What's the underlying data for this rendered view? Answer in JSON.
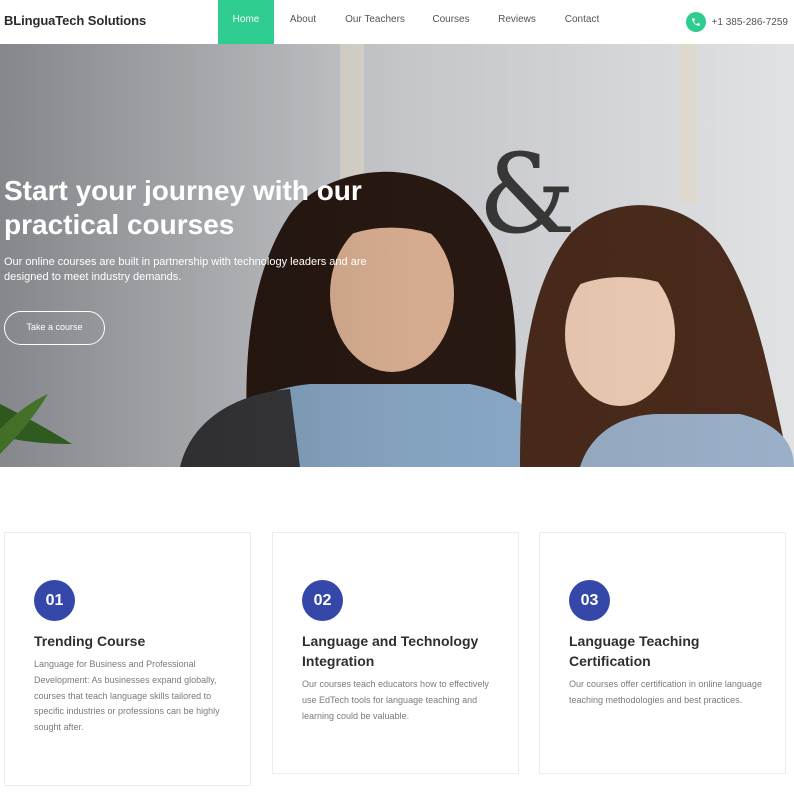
{
  "header": {
    "brand": "BLinguaTech Solutions",
    "nav": [
      {
        "label": "Home",
        "active": true
      },
      {
        "label": "About",
        "active": false
      },
      {
        "label": "Our Teachers",
        "active": false
      },
      {
        "label": "Courses",
        "active": false
      },
      {
        "label": "Reviews",
        "active": false
      },
      {
        "label": "Contact",
        "active": false
      }
    ],
    "phone": "+1 385-286-7259",
    "phone_icon": "phone-icon"
  },
  "hero": {
    "title": "Start your journey with our practical courses",
    "subtitle": "Our online courses are built in partnership with technology leaders and are designed to meet industry demands.",
    "cta": "Take a course"
  },
  "features": [
    {
      "number": "01",
      "title": "Trending Course",
      "description": "Language for Business and Professional Development: As businesses expand globally, courses that teach language skills tailored to specific industries or professions can be highly sought after."
    },
    {
      "number": "02",
      "title": "Language and Technology Integration",
      "description": "Our courses teach educators how to effectively use EdTech tools for language teaching and learning could be valuable."
    },
    {
      "number": "03",
      "title": "Language Teaching Certification",
      "description": "Our courses offer certification in online language teaching methodologies and best practices."
    }
  ],
  "colors": {
    "accent": "#2ecc8f",
    "number_badge": "#3547a8"
  }
}
